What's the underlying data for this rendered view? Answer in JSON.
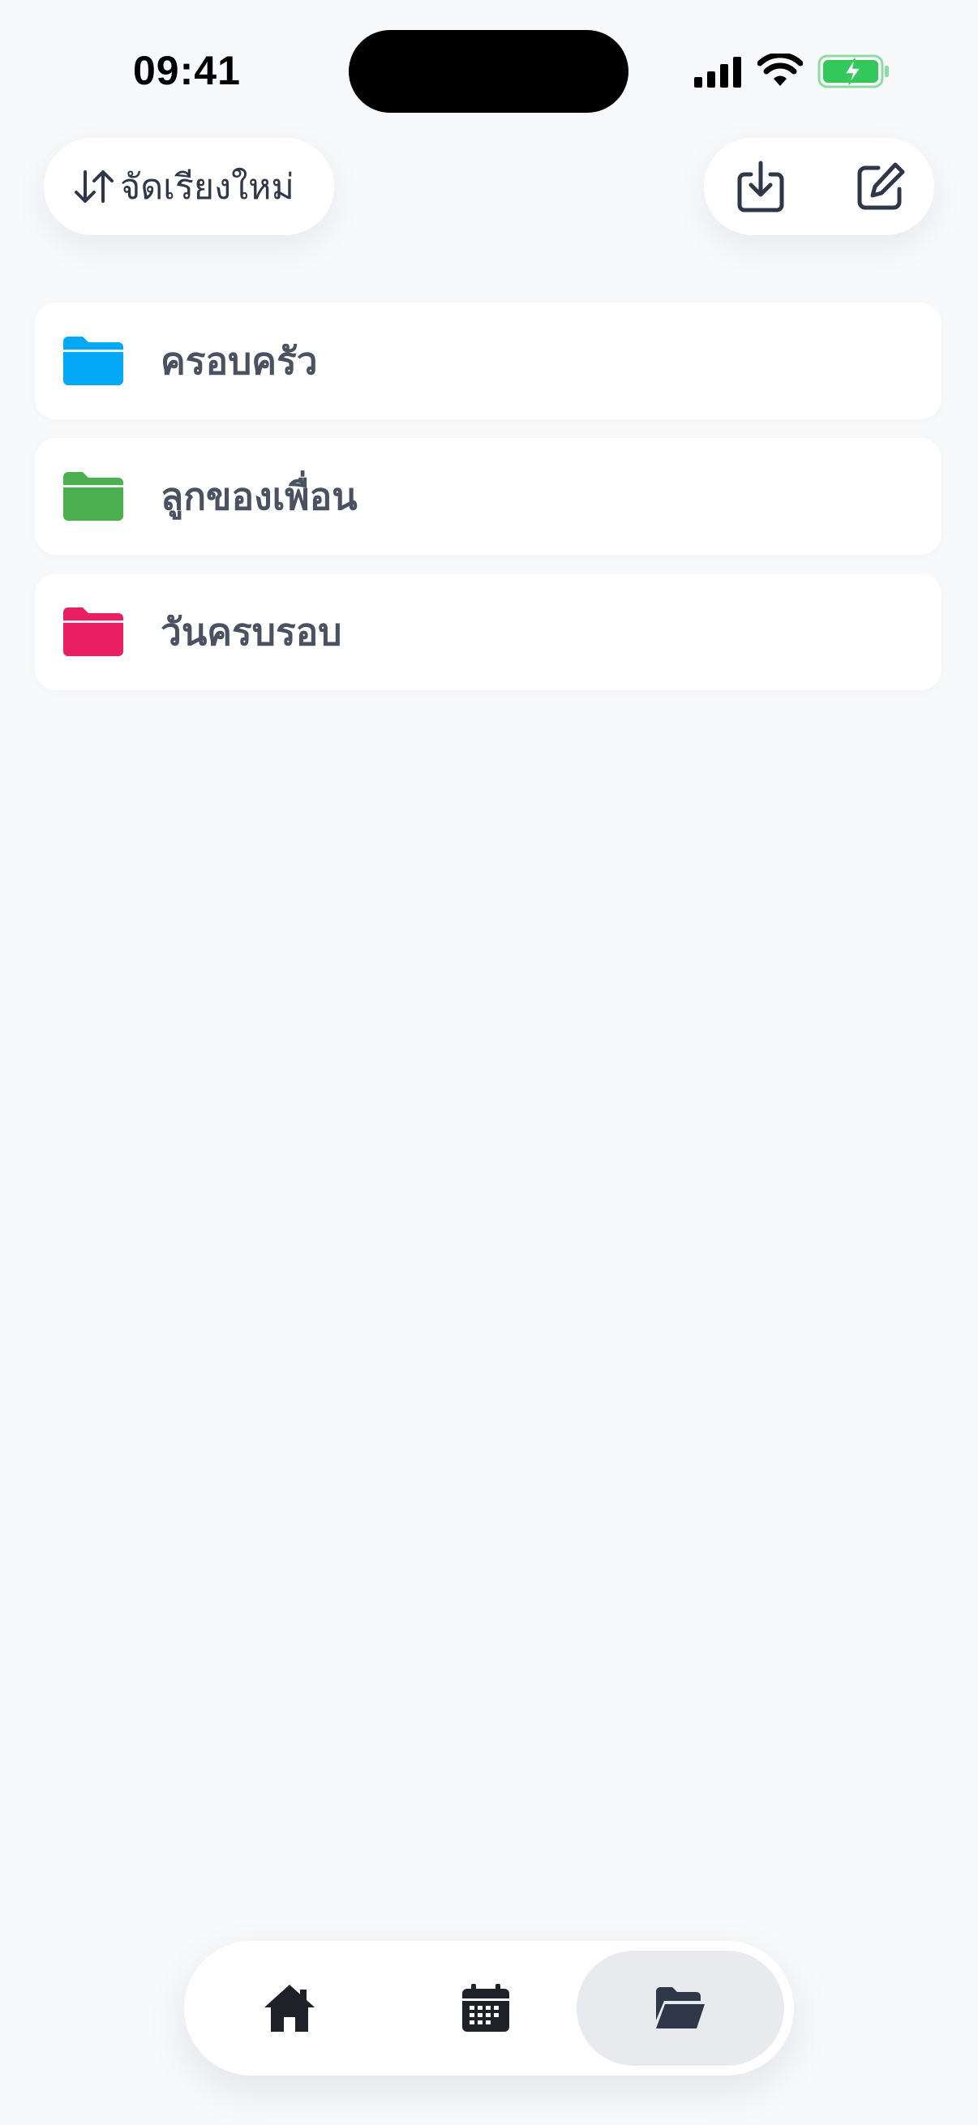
{
  "status_bar": {
    "time": "09:41"
  },
  "toolbar": {
    "sort_label": "จัดเรียงใหม่",
    "sort_icon": "arrows-up-down-icon",
    "import_icon": "tray-download-icon",
    "edit_icon": "compose-edit-icon"
  },
  "folders": [
    {
      "label": "ครอบครัว",
      "color": "#03a9f4"
    },
    {
      "label": "ลูกของเพื่อน",
      "color": "#4caf50"
    },
    {
      "label": "วันครบรอบ",
      "color": "#e91e63"
    }
  ],
  "tab_bar": {
    "items": [
      {
        "icon": "home-icon",
        "active": false
      },
      {
        "icon": "calendar-icon",
        "active": false
      },
      {
        "icon": "folder-open-icon",
        "active": true
      }
    ]
  },
  "colors": {
    "background": "#f8f9fb",
    "icon_dark": "#2f3849",
    "battery_green": "#34c759"
  }
}
